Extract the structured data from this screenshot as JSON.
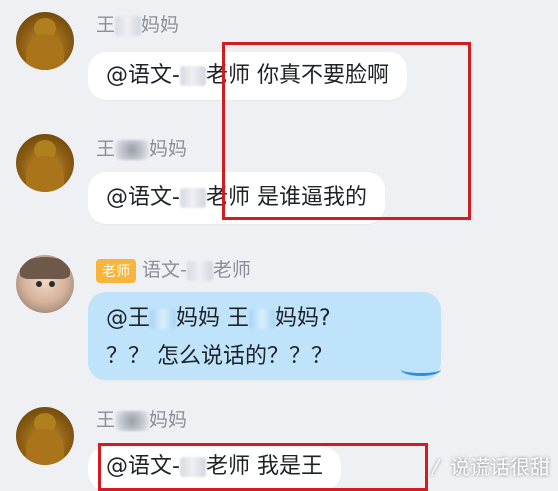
{
  "messages": [
    {
      "sender_prefix": "王",
      "sender_suffix": "妈妈",
      "text_prefix": "@语文-",
      "text_suffix": "老师 你真不要脸啊"
    },
    {
      "sender_prefix": "王",
      "sender_suffix": "妈妈",
      "text_prefix": "@语文-",
      "text_suffix": "老师 是谁逼我的"
    },
    {
      "badge": "老师",
      "sender_prefix": "语文-",
      "sender_suffix": "老师",
      "line1_a": "@王",
      "line1_b": "妈妈 王",
      "line1_c": "妈妈?",
      "line2": "？？ 怎么说话的？？？"
    },
    {
      "sender_prefix": "王",
      "sender_suffix": "妈妈",
      "text_prefix": "@语文-",
      "text_suffix": "老师 我是王"
    }
  ],
  "watermark": "说谎话很甜",
  "colors": {
    "highlight": "#d21c22",
    "teacher_bubble": "#bfe3fb",
    "badge": "#f7b53b"
  }
}
